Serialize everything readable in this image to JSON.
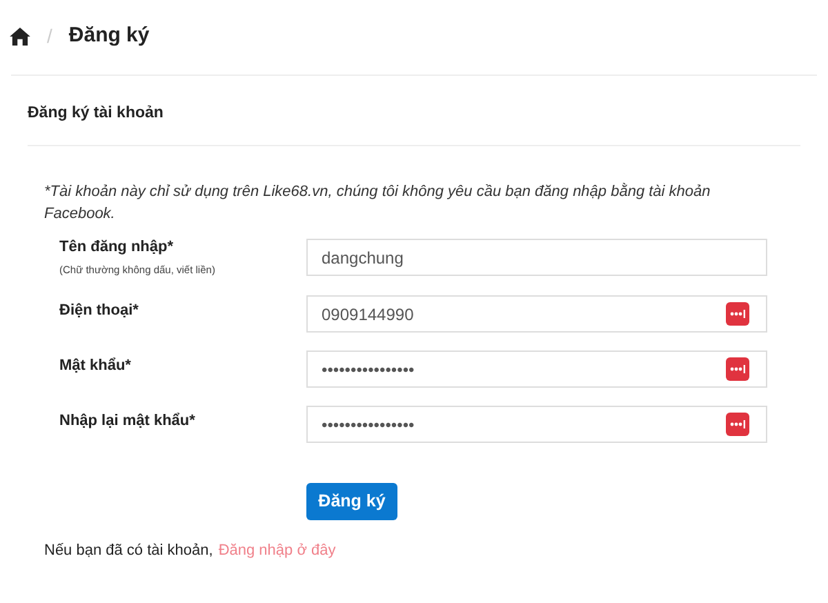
{
  "breadcrumb": {
    "separator": "/",
    "current": "Đăng ký"
  },
  "card": {
    "title": "Đăng ký tài khoản"
  },
  "note": "*Tài khoản này chỉ sử dụng trên Like68.vn, chúng tôi không yêu cầu bạn đăng nhập bằng tài khoản Facebook.",
  "fields": [
    {
      "label": "Tên đăng nhập*",
      "hint": "(Chữ thường không dấu, viết liền)",
      "value": "dangchung",
      "autofill_icon": false
    },
    {
      "label": "Điện thoại*",
      "value": "0909144990",
      "autofill_icon": true
    },
    {
      "label": "Mật khẩu*",
      "value": "••••••••••••••••",
      "autofill_icon": true
    },
    {
      "label": "Nhập lại mật khẩu*",
      "value": "••••••••••••••••",
      "autofill_icon": true
    }
  ],
  "submit": "Đăng ký",
  "footer": {
    "text": "Nếu bạn đã có tài khoản,",
    "link": "Đăng nhập ở đây"
  }
}
